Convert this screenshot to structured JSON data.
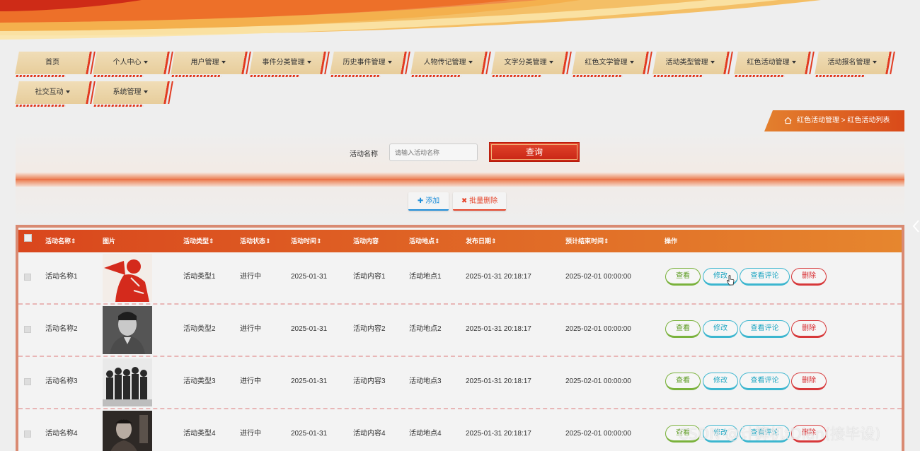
{
  "nav": {
    "items": [
      {
        "label": "首页",
        "dropdown": false
      },
      {
        "label": "个人中心",
        "dropdown": true
      },
      {
        "label": "用户管理",
        "dropdown": true
      },
      {
        "label": "事件分类管理",
        "dropdown": true
      },
      {
        "label": "历史事件管理",
        "dropdown": true
      },
      {
        "label": "人物传记管理",
        "dropdown": true
      },
      {
        "label": "文字分类管理",
        "dropdown": true
      },
      {
        "label": "红色文学管理",
        "dropdown": true
      },
      {
        "label": "活动类型管理",
        "dropdown": true
      },
      {
        "label": "红色活动管理",
        "dropdown": true
      },
      {
        "label": "活动报名管理",
        "dropdown": true
      },
      {
        "label": "社交互动",
        "dropdown": true
      },
      {
        "label": "系统管理",
        "dropdown": true
      }
    ]
  },
  "breadcrumb": {
    "text": "红色活动管理 > 红色活动列表"
  },
  "search": {
    "label": "活动名称",
    "placeholder": "请输入活动名称",
    "button": "查询"
  },
  "actions": {
    "add": "添加",
    "batch_delete": "批量删除"
  },
  "table": {
    "headers": {
      "name": "活动名称",
      "image": "图片",
      "type": "活动类型",
      "status": "活动状态",
      "time": "活动时间",
      "content": "活动内容",
      "location": "活动地点",
      "publish": "发布日期",
      "end": "预计结束时间",
      "ops": "操作"
    },
    "rows": [
      {
        "name": "活动名称1",
        "image_icon": "propaganda-poster-image",
        "type": "活动类型1",
        "status": "进行中",
        "time": "2025-01-31",
        "content": "活动内容1",
        "location": "活动地点1",
        "publish": "2025-01-31 20:18:17",
        "end": "2025-02-01 00:00:00"
      },
      {
        "name": "活动名称2",
        "image_icon": "soldier-portrait-image",
        "type": "活动类型2",
        "status": "进行中",
        "time": "2025-01-31",
        "content": "活动内容2",
        "location": "活动地点2",
        "publish": "2025-01-31 20:18:17",
        "end": "2025-02-01 00:00:00"
      },
      {
        "name": "活动名称3",
        "image_icon": "group-photo-image",
        "type": "活动类型3",
        "status": "进行中",
        "time": "2025-01-31",
        "content": "活动内容3",
        "location": "活动地点3",
        "publish": "2025-01-31 20:18:17",
        "end": "2025-02-01 00:00:00"
      },
      {
        "name": "活动名称4",
        "image_icon": "movie-poster-image",
        "type": "活动类型4",
        "status": "进行中",
        "time": "2025-01-31",
        "content": "活动内容4",
        "location": "活动地点4",
        "publish": "2025-01-31 20:18:17",
        "end": "2025-02-01 00:00:00"
      }
    ],
    "op_labels": {
      "view": "查看",
      "edit": "修改",
      "comments": "查看评论",
      "delete": "删除"
    }
  },
  "watermark": "CSDN @计算机tDian(接毕设)",
  "colors": {
    "accent": "#e23a20",
    "header_gradient_start": "#d9461d",
    "header_gradient_end": "#e6862e",
    "nav_tab": "#ecd5a8"
  }
}
